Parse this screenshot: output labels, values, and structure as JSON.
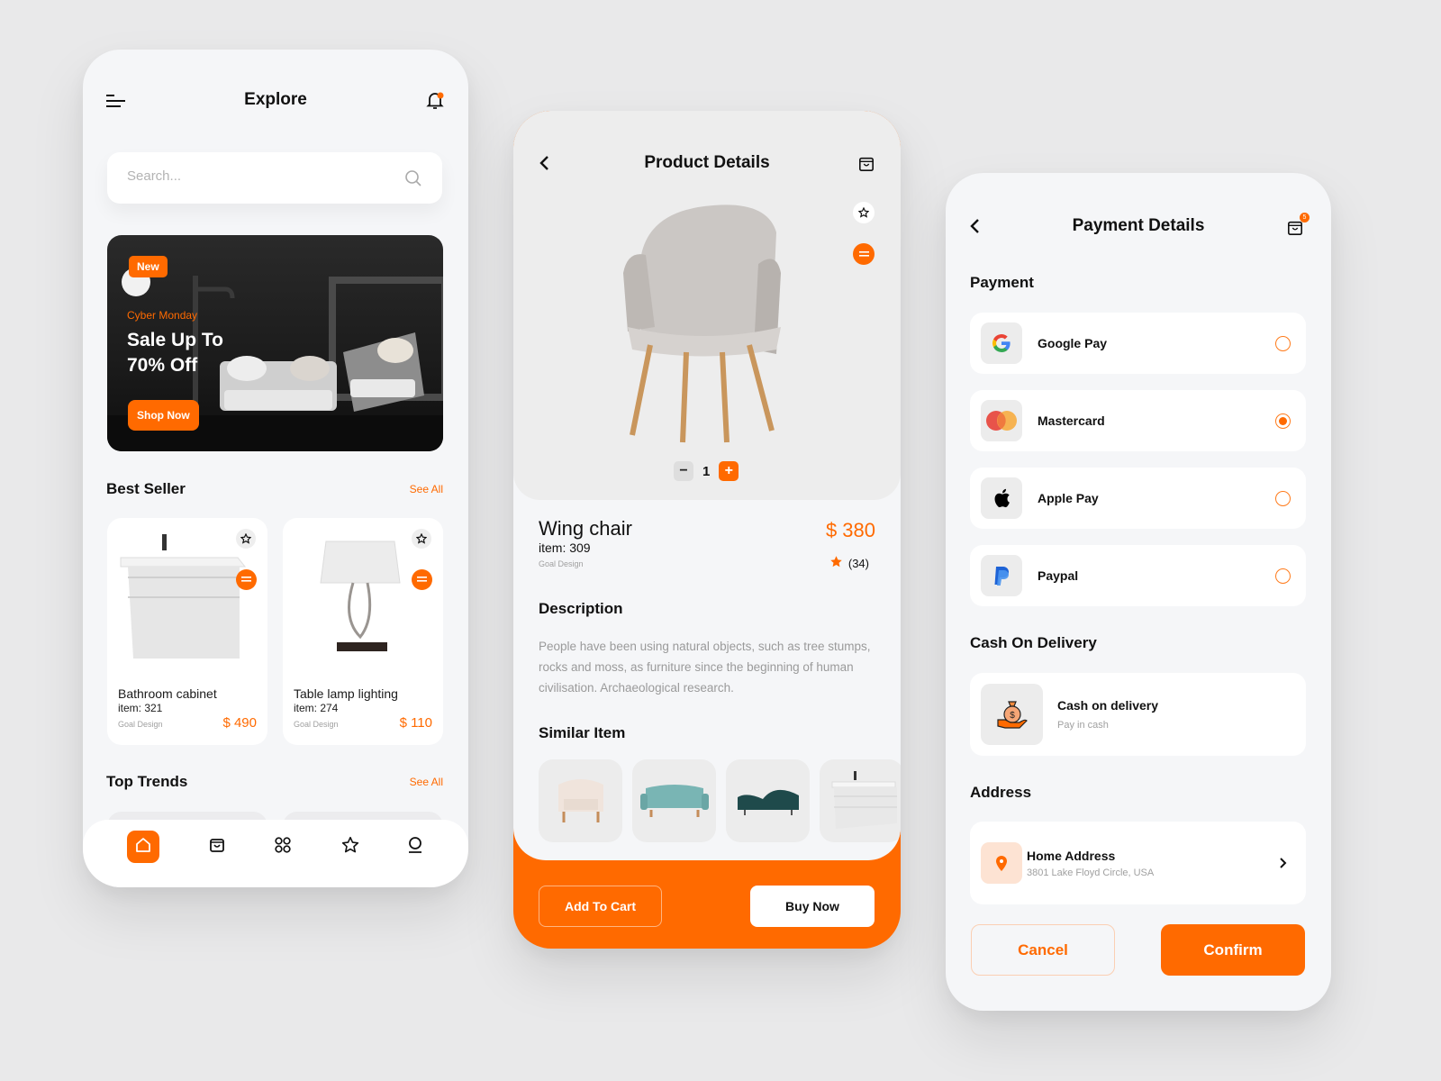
{
  "theme": {
    "accent": "#ff6a00",
    "background": "#e9e9ea",
    "card": "#ffffff",
    "screen": "#f5f6f8"
  },
  "explore": {
    "title": "Explore",
    "search_placeholder": "Search...",
    "banner": {
      "badge": "New",
      "kicker": "Cyber Monday",
      "headline": "Sale Up To 70% Off",
      "cta": "Shop Now"
    },
    "best_seller": {
      "title": "Best Seller",
      "see_all": "See All",
      "items": [
        {
          "name": "Bathroom cabinet",
          "item": "item: 321",
          "brand": "Goal Design",
          "price": "$ 490"
        },
        {
          "name": "Table lamp lighting",
          "item": "item: 274",
          "brand": "Goal Design",
          "price": "$ 110"
        }
      ]
    },
    "top_trends": {
      "title": "Top Trends",
      "see_all": "See All"
    },
    "nav": [
      "home-icon",
      "shopping-bag-icon",
      "categories-icon",
      "favorites-icon",
      "profile-icon"
    ]
  },
  "product": {
    "title": "Product Details",
    "quantity": "1",
    "minus": "−",
    "plus": "+",
    "name": "Wing chair",
    "item": "item: 309",
    "brand": "Goal Design",
    "price": "$ 380",
    "reviews": "(34)",
    "description_title": "Description",
    "description": "People have been using natural objects, such as tree stumps, rocks and moss, as furniture since the beginning of human civilisation. Archaeological research.",
    "similar_title": "Similar Item",
    "similar": [
      "Tub armchair",
      "Teal sofa",
      "Camelback sofa",
      "Bathroom cabinet"
    ],
    "add_to_cart": "Add To Cart",
    "buy_now": "Buy Now"
  },
  "payment": {
    "title": "Payment Details",
    "cart_count": "5",
    "payment_title": "Payment",
    "methods": [
      {
        "label": "Google Pay",
        "selected": false
      },
      {
        "label": "Mastercard",
        "selected": true
      },
      {
        "label": "Apple Pay",
        "selected": false
      },
      {
        "label": "Paypal",
        "selected": false
      }
    ],
    "cod_title": "Cash On Delivery",
    "cod": {
      "label": "Cash on delivery",
      "sub": "Pay in cash"
    },
    "address_title": "Address",
    "address": {
      "label": "Home Address",
      "value": "3801 Lake Floyd Circle, USA"
    },
    "cancel": "Cancel",
    "confirm": "Confirm"
  }
}
